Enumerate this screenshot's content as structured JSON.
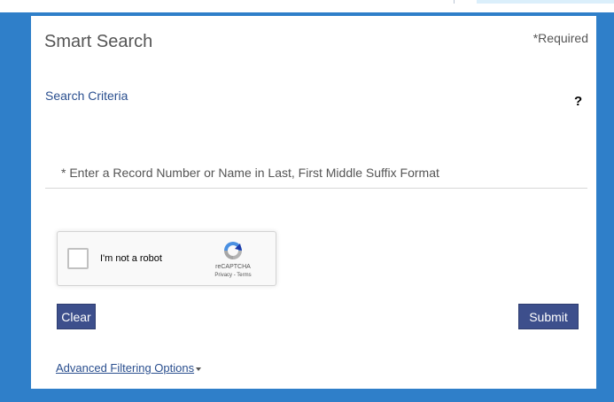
{
  "form": {
    "title": "Smart Search",
    "required_note": "*Required",
    "criteria_label": "Search Criteria",
    "help_symbol": "?",
    "search_placeholder": "* Enter a Record Number or Name in Last, First Middle Suffix Format",
    "search_value": ""
  },
  "captcha": {
    "label": "I'm not a robot",
    "brand": "reCAPTCHA",
    "links": "Privacy - Terms",
    "checked": false
  },
  "buttons": {
    "clear": "Clear",
    "submit": "Submit"
  },
  "advanced": {
    "label": "Advanced Filtering Options"
  },
  "colors": {
    "frame": "#2f7fc9",
    "button": "#3d4f8c",
    "link": "#2a4f8f",
    "title_text": "#555555"
  },
  "icons": {
    "help": "question-mark-icon",
    "captcha": "recaptcha-logo-icon",
    "dropdown": "caret-down-icon"
  }
}
